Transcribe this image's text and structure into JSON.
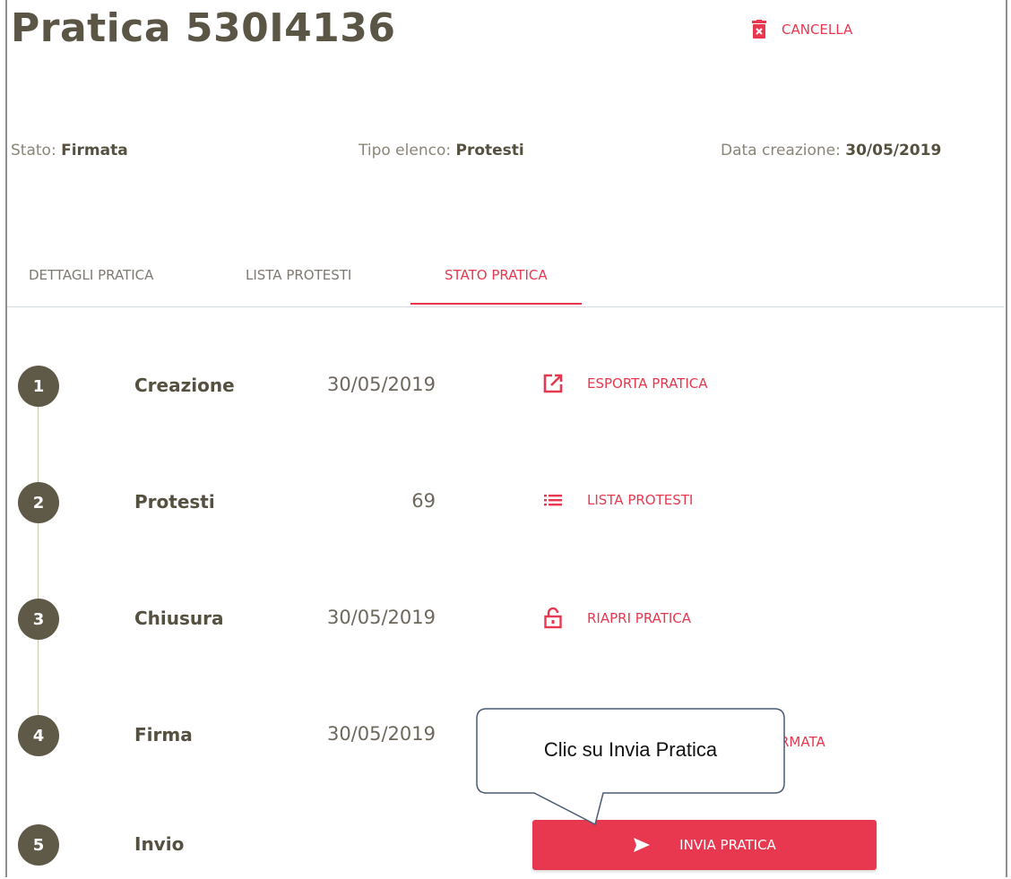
{
  "header": {
    "title": "Pratica 530I4136",
    "cancel_label": "CANCELLA"
  },
  "meta": {
    "stato_label": "Stato:",
    "stato_value": "Firmata",
    "tipo_label": "Tipo elenco:",
    "tipo_value": "Protesti",
    "data_label": "Data creazione:",
    "data_value": "30/05/2019"
  },
  "tabs": [
    {
      "label": "DETTAGLI PRATICA"
    },
    {
      "label": "LISTA PROTESTI"
    },
    {
      "label": "STATO PRATICA",
      "active": true
    }
  ],
  "steps": [
    {
      "number": "1",
      "name": "Creazione",
      "value": "30/05/2019",
      "action_label": "ESPORTA PRATICA",
      "action_icon": "external-link-icon"
    },
    {
      "number": "2",
      "name": "Protesti",
      "value": "69",
      "action_label": "LISTA PROTESTI",
      "action_icon": "list-icon"
    },
    {
      "number": "3",
      "name": "Chiusura",
      "value": "30/05/2019",
      "action_label": "RIAPRI PRATICA",
      "action_icon": "unlock-icon"
    },
    {
      "number": "4",
      "name": "Firma",
      "value": "30/05/2019",
      "action_label": "RMATA",
      "action_icon": ""
    },
    {
      "number": "5",
      "name": "Invio",
      "value": "",
      "action_label": "INVIA PRATICA",
      "action_icon": "send-icon"
    }
  ],
  "callout": {
    "text": "Clic su Invia Pratica"
  },
  "colors": {
    "accent": "#e8384f",
    "step_circle": "#5f5a47"
  }
}
